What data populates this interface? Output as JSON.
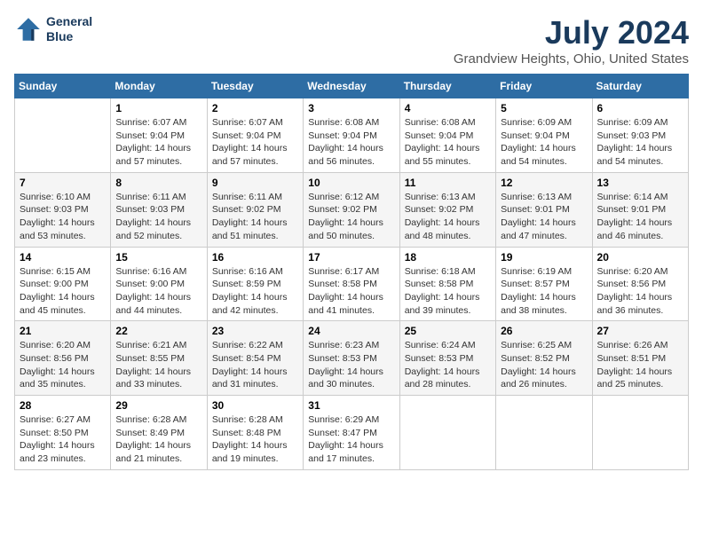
{
  "header": {
    "logo_line1": "General",
    "logo_line2": "Blue",
    "title": "July 2024",
    "subtitle": "Grandview Heights, Ohio, United States"
  },
  "columns": [
    "Sunday",
    "Monday",
    "Tuesday",
    "Wednesday",
    "Thursday",
    "Friday",
    "Saturday"
  ],
  "weeks": [
    [
      {
        "day": "",
        "info": ""
      },
      {
        "day": "1",
        "info": "Sunrise: 6:07 AM\nSunset: 9:04 PM\nDaylight: 14 hours\nand 57 minutes."
      },
      {
        "day": "2",
        "info": "Sunrise: 6:07 AM\nSunset: 9:04 PM\nDaylight: 14 hours\nand 57 minutes."
      },
      {
        "day": "3",
        "info": "Sunrise: 6:08 AM\nSunset: 9:04 PM\nDaylight: 14 hours\nand 56 minutes."
      },
      {
        "day": "4",
        "info": "Sunrise: 6:08 AM\nSunset: 9:04 PM\nDaylight: 14 hours\nand 55 minutes."
      },
      {
        "day": "5",
        "info": "Sunrise: 6:09 AM\nSunset: 9:04 PM\nDaylight: 14 hours\nand 54 minutes."
      },
      {
        "day": "6",
        "info": "Sunrise: 6:09 AM\nSunset: 9:03 PM\nDaylight: 14 hours\nand 54 minutes."
      }
    ],
    [
      {
        "day": "7",
        "info": "Sunrise: 6:10 AM\nSunset: 9:03 PM\nDaylight: 14 hours\nand 53 minutes."
      },
      {
        "day": "8",
        "info": "Sunrise: 6:11 AM\nSunset: 9:03 PM\nDaylight: 14 hours\nand 52 minutes."
      },
      {
        "day": "9",
        "info": "Sunrise: 6:11 AM\nSunset: 9:02 PM\nDaylight: 14 hours\nand 51 minutes."
      },
      {
        "day": "10",
        "info": "Sunrise: 6:12 AM\nSunset: 9:02 PM\nDaylight: 14 hours\nand 50 minutes."
      },
      {
        "day": "11",
        "info": "Sunrise: 6:13 AM\nSunset: 9:02 PM\nDaylight: 14 hours\nand 48 minutes."
      },
      {
        "day": "12",
        "info": "Sunrise: 6:13 AM\nSunset: 9:01 PM\nDaylight: 14 hours\nand 47 minutes."
      },
      {
        "day": "13",
        "info": "Sunrise: 6:14 AM\nSunset: 9:01 PM\nDaylight: 14 hours\nand 46 minutes."
      }
    ],
    [
      {
        "day": "14",
        "info": "Sunrise: 6:15 AM\nSunset: 9:00 PM\nDaylight: 14 hours\nand 45 minutes."
      },
      {
        "day": "15",
        "info": "Sunrise: 6:16 AM\nSunset: 9:00 PM\nDaylight: 14 hours\nand 44 minutes."
      },
      {
        "day": "16",
        "info": "Sunrise: 6:16 AM\nSunset: 8:59 PM\nDaylight: 14 hours\nand 42 minutes."
      },
      {
        "day": "17",
        "info": "Sunrise: 6:17 AM\nSunset: 8:58 PM\nDaylight: 14 hours\nand 41 minutes."
      },
      {
        "day": "18",
        "info": "Sunrise: 6:18 AM\nSunset: 8:58 PM\nDaylight: 14 hours\nand 39 minutes."
      },
      {
        "day": "19",
        "info": "Sunrise: 6:19 AM\nSunset: 8:57 PM\nDaylight: 14 hours\nand 38 minutes."
      },
      {
        "day": "20",
        "info": "Sunrise: 6:20 AM\nSunset: 8:56 PM\nDaylight: 14 hours\nand 36 minutes."
      }
    ],
    [
      {
        "day": "21",
        "info": "Sunrise: 6:20 AM\nSunset: 8:56 PM\nDaylight: 14 hours\nand 35 minutes."
      },
      {
        "day": "22",
        "info": "Sunrise: 6:21 AM\nSunset: 8:55 PM\nDaylight: 14 hours\nand 33 minutes."
      },
      {
        "day": "23",
        "info": "Sunrise: 6:22 AM\nSunset: 8:54 PM\nDaylight: 14 hours\nand 31 minutes."
      },
      {
        "day": "24",
        "info": "Sunrise: 6:23 AM\nSunset: 8:53 PM\nDaylight: 14 hours\nand 30 minutes."
      },
      {
        "day": "25",
        "info": "Sunrise: 6:24 AM\nSunset: 8:53 PM\nDaylight: 14 hours\nand 28 minutes."
      },
      {
        "day": "26",
        "info": "Sunrise: 6:25 AM\nSunset: 8:52 PM\nDaylight: 14 hours\nand 26 minutes."
      },
      {
        "day": "27",
        "info": "Sunrise: 6:26 AM\nSunset: 8:51 PM\nDaylight: 14 hours\nand 25 minutes."
      }
    ],
    [
      {
        "day": "28",
        "info": "Sunrise: 6:27 AM\nSunset: 8:50 PM\nDaylight: 14 hours\nand 23 minutes."
      },
      {
        "day": "29",
        "info": "Sunrise: 6:28 AM\nSunset: 8:49 PM\nDaylight: 14 hours\nand 21 minutes."
      },
      {
        "day": "30",
        "info": "Sunrise: 6:28 AM\nSunset: 8:48 PM\nDaylight: 14 hours\nand 19 minutes."
      },
      {
        "day": "31",
        "info": "Sunrise: 6:29 AM\nSunset: 8:47 PM\nDaylight: 14 hours\nand 17 minutes."
      },
      {
        "day": "",
        "info": ""
      },
      {
        "day": "",
        "info": ""
      },
      {
        "day": "",
        "info": ""
      }
    ]
  ]
}
